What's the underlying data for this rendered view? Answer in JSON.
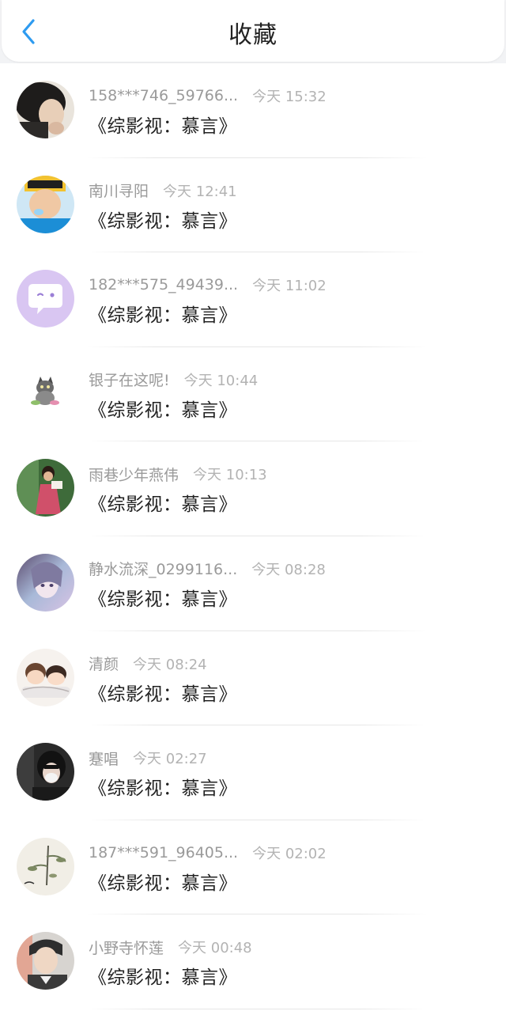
{
  "header": {
    "title": "收藏",
    "back_icon": "chevron-left-icon",
    "accent_color": "#2e9bf0"
  },
  "favorites": [
    {
      "user": "158***746_59766...",
      "time": "今天 15:32",
      "book": "《综影视：慕言》",
      "avatar_icon": "person-photo-avatar"
    },
    {
      "user": "南川寻阳",
      "time": "今天 12:41",
      "book": "《综影视：慕言》",
      "avatar_icon": "child-photo-avatar"
    },
    {
      "user": "182***575_49439...",
      "time": "今天 11:02",
      "book": "《综影视：慕言》",
      "avatar_icon": "chat-bubble-avatar"
    },
    {
      "user": "银子在这呢!",
      "time": "今天 10:44",
      "book": "《综影视：慕言》",
      "avatar_icon": "cat-avatar"
    },
    {
      "user": "雨巷少年燕伟",
      "time": "今天 10:13",
      "book": "《综影视：慕言》",
      "avatar_icon": "person-photo-avatar"
    },
    {
      "user": "静水流深_0299116...",
      "time": "今天 08:28",
      "book": "《综影视：慕言》",
      "avatar_icon": "anime-portrait-avatar"
    },
    {
      "user": "清颜",
      "time": "今天 08:24",
      "book": "《综影视：慕言》",
      "avatar_icon": "cartoon-couple-avatar"
    },
    {
      "user": "蹇唱",
      "time": "今天 02:27",
      "book": "《综影视：慕言》",
      "avatar_icon": "masked-person-avatar"
    },
    {
      "user": "187***591_96405...",
      "time": "今天 02:02",
      "book": "《综影视：慕言》",
      "avatar_icon": "ink-painting-avatar"
    },
    {
      "user": "小野寺怀莲",
      "time": "今天 00:48",
      "book": "《综影视：慕言》",
      "avatar_icon": "person-photo-avatar"
    }
  ]
}
